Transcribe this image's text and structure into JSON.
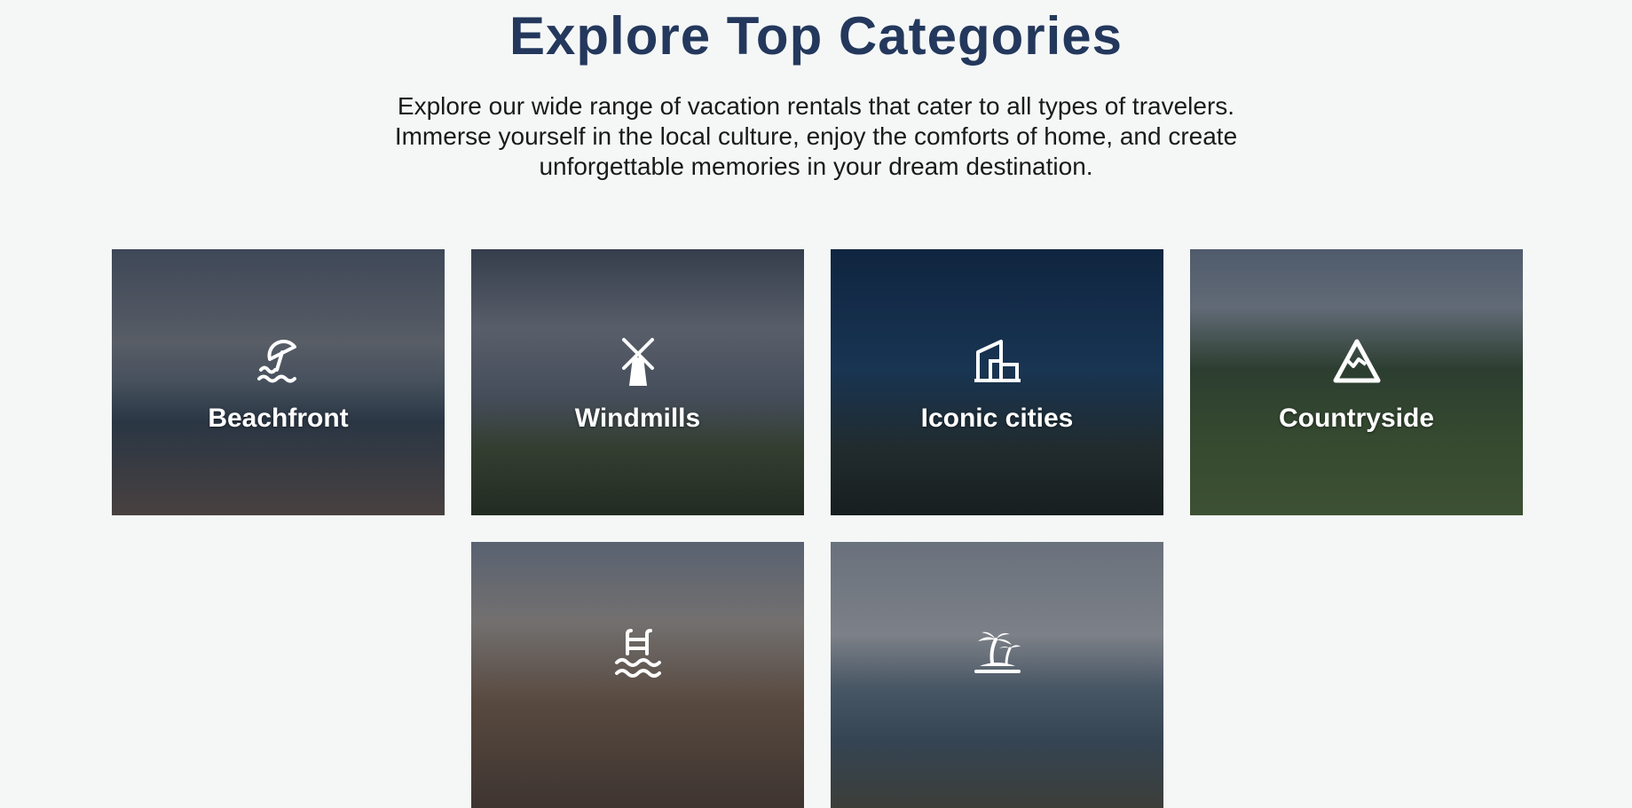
{
  "header": {
    "title": "Explore Top Categories",
    "description": "Explore our wide range of vacation rentals that cater to all types of travelers. Immerse yourself in the local culture, enjoy the comforts of home, and create unforgettable memories in your dream destination."
  },
  "categories": [
    {
      "label": "Beachfront",
      "icon": "beach-umbrella-icon"
    },
    {
      "label": "Windmills",
      "icon": "windmill-icon"
    },
    {
      "label": "Iconic cities",
      "icon": "city-building-icon"
    },
    {
      "label": "Countryside",
      "icon": "mountain-icon"
    },
    {
      "label": "",
      "icon": "pool-ladder-icon"
    },
    {
      "label": "",
      "icon": "palm-island-icon"
    }
  ],
  "colors": {
    "title": "#23385c",
    "background": "#f5f7f7",
    "card_label": "#ffffff"
  }
}
